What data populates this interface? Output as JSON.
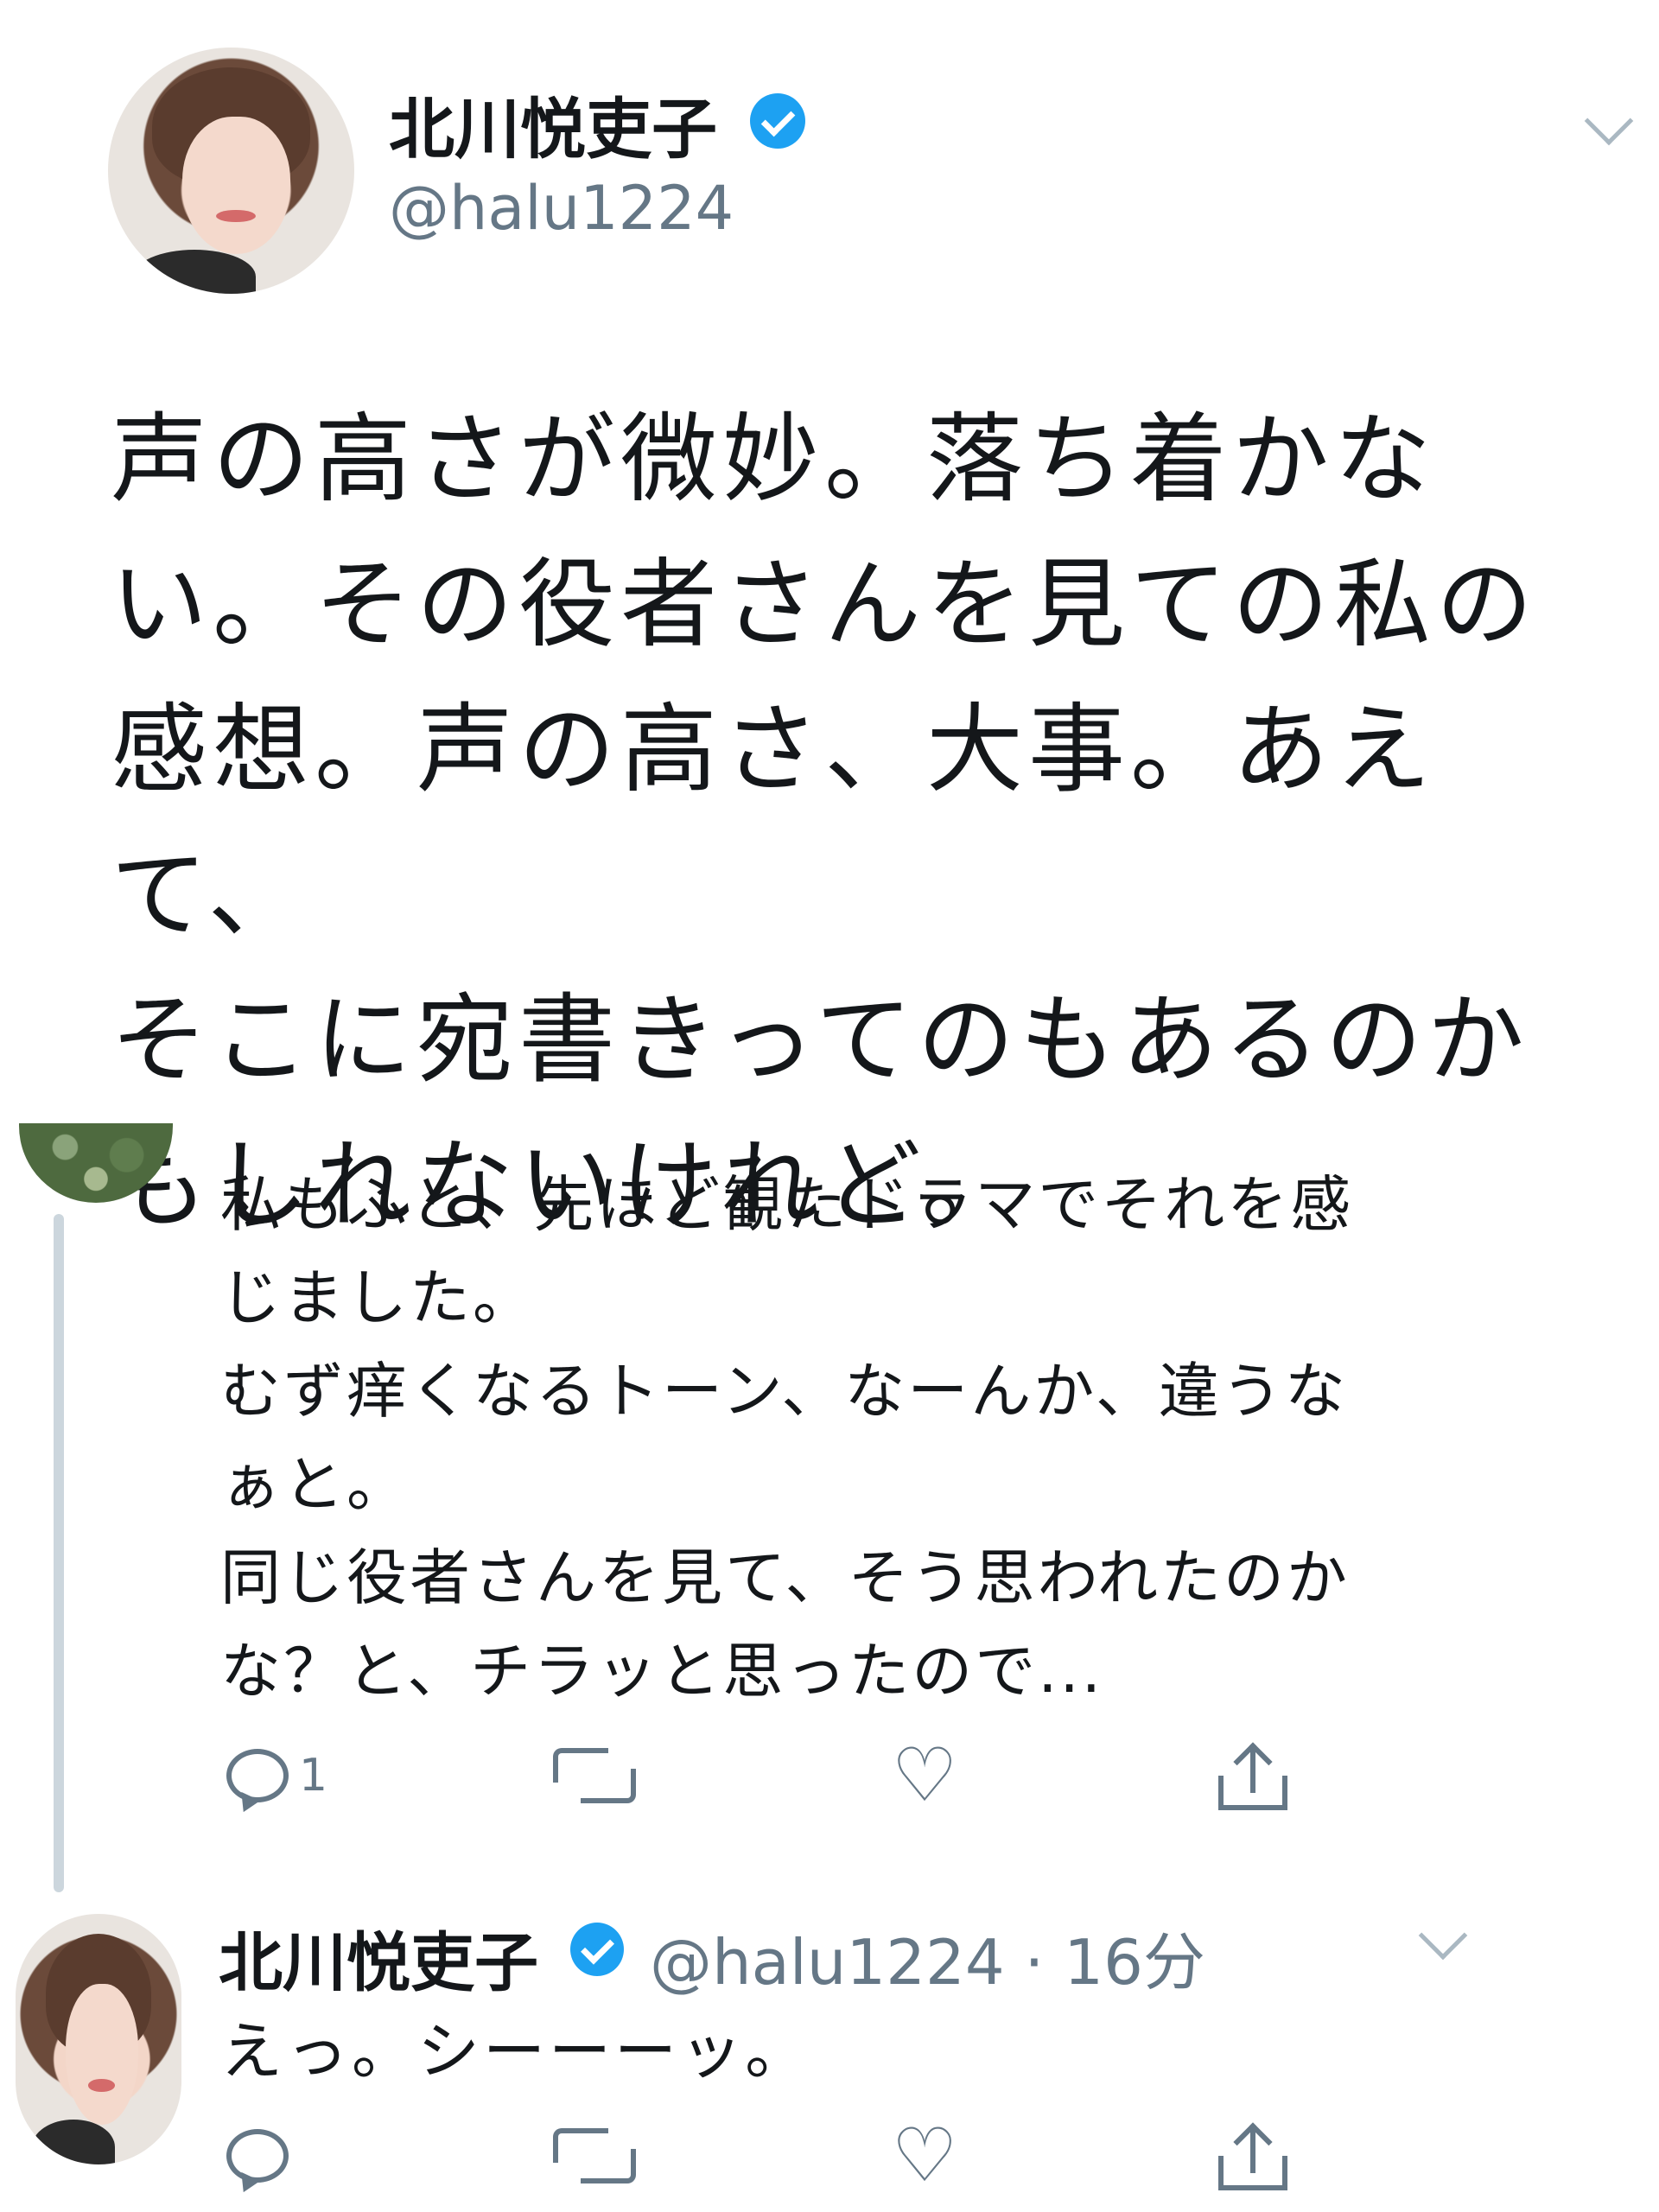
{
  "main_tweet": {
    "display_name": "北川悦吏子",
    "handle": "@halu1224",
    "text": "声の高さが微妙。落ち着かな\nい。その役者さんを見ての私の\n感想。声の高さ、大事。あえて、\nそこに宛書きってのもあるのか\nもしれないけれど。"
  },
  "reply_1": {
    "text": "私もふと、先ほど観たドラマでそれを感\nじました。\nむず痒くなるトーン、なーんか、違うな\nぁと。\n同じ役者さんを見て、そう思われたのか\nな？と、チラッと思ったので...",
    "actions": {
      "reply_count": "1"
    }
  },
  "reply_2": {
    "display_name": "北川悦吏子",
    "handle_time": "@halu1224 · 16分",
    "text": "えっ。シーーーッ。"
  },
  "icons": {
    "verified": "verified-badge-icon",
    "caret": "chevron-down-icon",
    "reply": "reply-icon",
    "retweet": "retweet-icon",
    "like": "heart-icon",
    "share": "share-icon"
  },
  "colors": {
    "verified": "#1da1f2",
    "icon_gray": "#657786",
    "thread_line": "#ccd6dd"
  }
}
